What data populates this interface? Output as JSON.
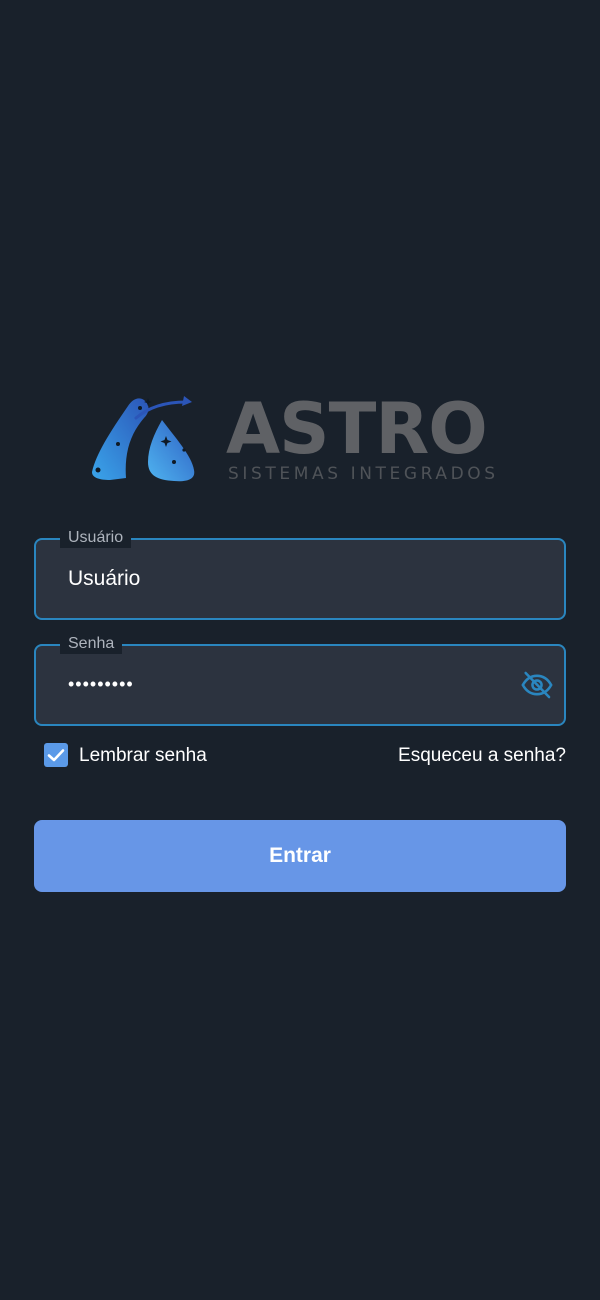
{
  "logo": {
    "wordmark": "ASTRO",
    "tagline": "SISTEMAS INTEGRADOS"
  },
  "form": {
    "username": {
      "label": "Usuário",
      "value": "Usuário"
    },
    "password": {
      "label": "Senha",
      "value": "•••••••••"
    },
    "remember": {
      "label": "Lembrar senha",
      "checked": true
    },
    "forgot_label": "Esqueceu a senha?",
    "submit_label": "Entrar"
  },
  "colors": {
    "background": "#19212b",
    "field_border": "#2a86bf",
    "field_fill": "#2c333f",
    "button": "#6796e7",
    "checkbox": "#5b9ae8",
    "wordmark": "#5f6165",
    "eye_icon": "#2a86bf"
  },
  "icons": {
    "logo_mark": "rocket-drop-logo-icon",
    "password_toggle": "eye-off-icon",
    "checkbox": "check-icon"
  }
}
